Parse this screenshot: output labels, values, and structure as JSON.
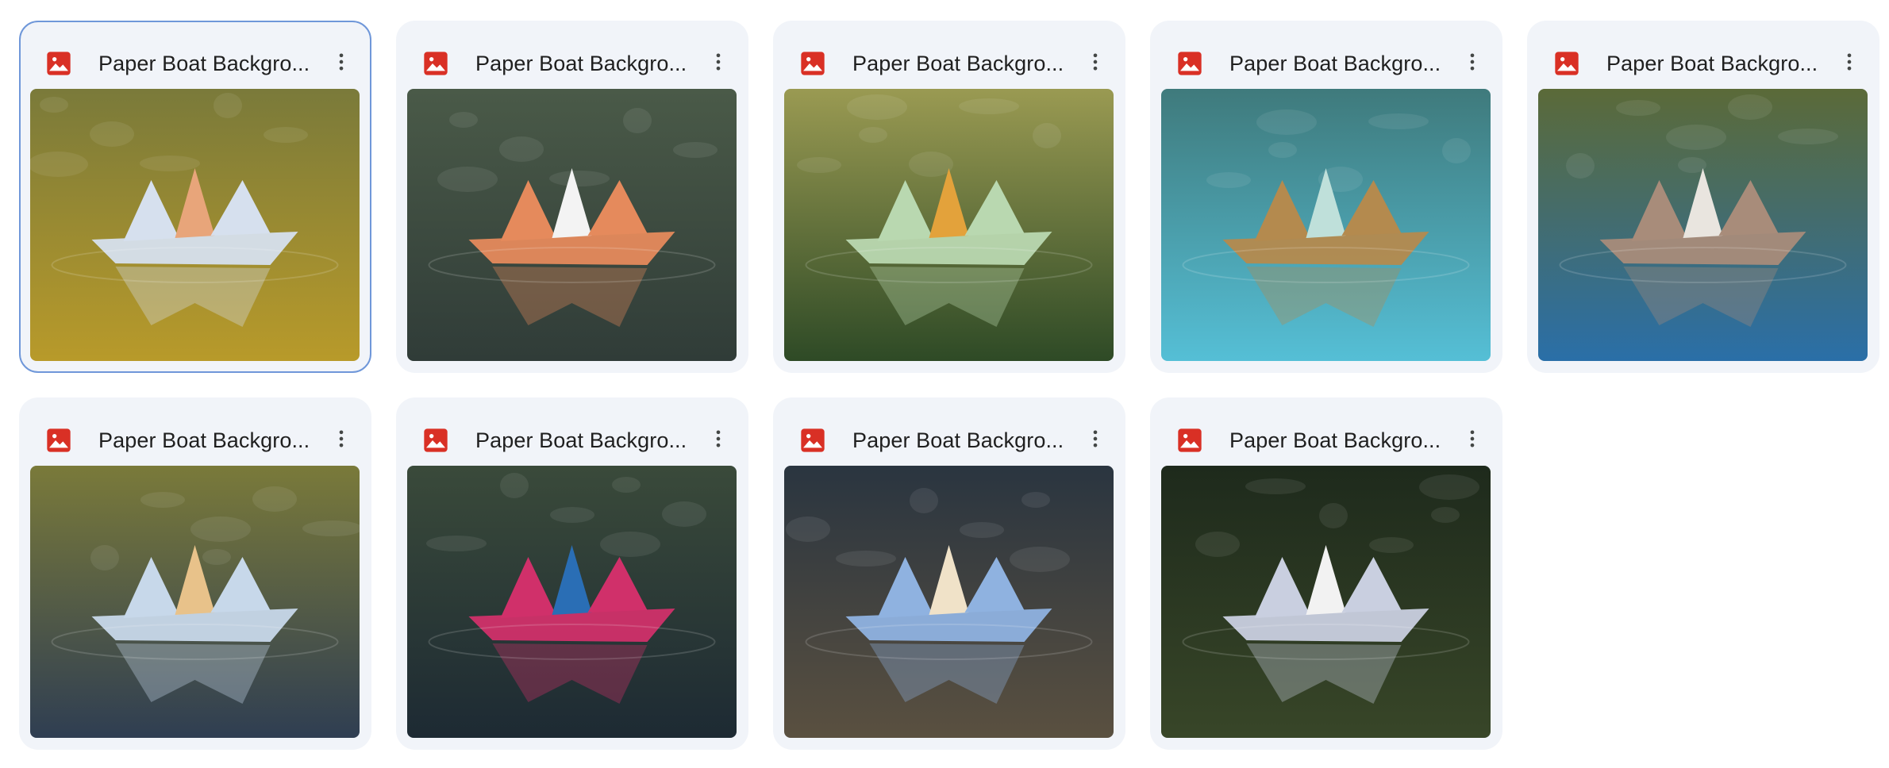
{
  "files": [
    {
      "title": "Paper Boat Backgro...",
      "icon": "image-file-icon",
      "bg_top": "#7a7a3a",
      "bg_bottom": "#b89a2a",
      "boat": "#d6e0ee",
      "accent": "#e8a57a",
      "selected": true
    },
    {
      "title": "Paper Boat Backgro...",
      "icon": "image-file-icon",
      "bg_top": "#4a5a48",
      "bg_bottom": "#303c38",
      "boat": "#e58a5c",
      "accent": "#f3f3f3",
      "selected": false
    },
    {
      "title": "Paper Boat Backgro...",
      "icon": "image-file-icon",
      "bg_top": "#9a9a52",
      "bg_bottom": "#2e4a26",
      "boat": "#b9d8b0",
      "accent": "#e3a23b",
      "selected": false
    },
    {
      "title": "Paper Boat Backgro...",
      "icon": "image-file-icon",
      "bg_top": "#3f7a7c",
      "bg_bottom": "#55bfd6",
      "boat": "#b48a4e",
      "accent": "#bfe0da",
      "selected": false
    },
    {
      "title": "Paper Boat Backgro...",
      "icon": "image-file-icon",
      "bg_top": "#5b6a38",
      "bg_bottom": "#2a6fa8",
      "boat": "#a88c7a",
      "accent": "#e9e5df",
      "selected": false
    },
    {
      "title": "Paper Boat Backgro...",
      "icon": "image-file-icon",
      "bg_top": "#7a7a3a",
      "bg_bottom": "#2f3e52",
      "boat": "#c7d8ea",
      "accent": "#e8c28a",
      "selected": false
    },
    {
      "title": "Paper Boat Backgro...",
      "icon": "image-file-icon",
      "bg_top": "#3a4a3a",
      "bg_bottom": "#1d2a33",
      "boat": "#d0306a",
      "accent": "#2a6eb5",
      "selected": false
    },
    {
      "title": "Paper Boat Backgro...",
      "icon": "image-file-icon",
      "bg_top": "#2a3540",
      "bg_bottom": "#5a5040",
      "boat": "#8fb2e0",
      "accent": "#f0e2c8",
      "selected": false
    },
    {
      "title": "Paper Boat Backgro...",
      "icon": "image-file-icon",
      "bg_top": "#1e2a1c",
      "bg_bottom": "#384628",
      "boat": "#c9cfe0",
      "accent": "#f2f2f2",
      "selected": false
    }
  ],
  "more_icon": "more-vertical-icon"
}
